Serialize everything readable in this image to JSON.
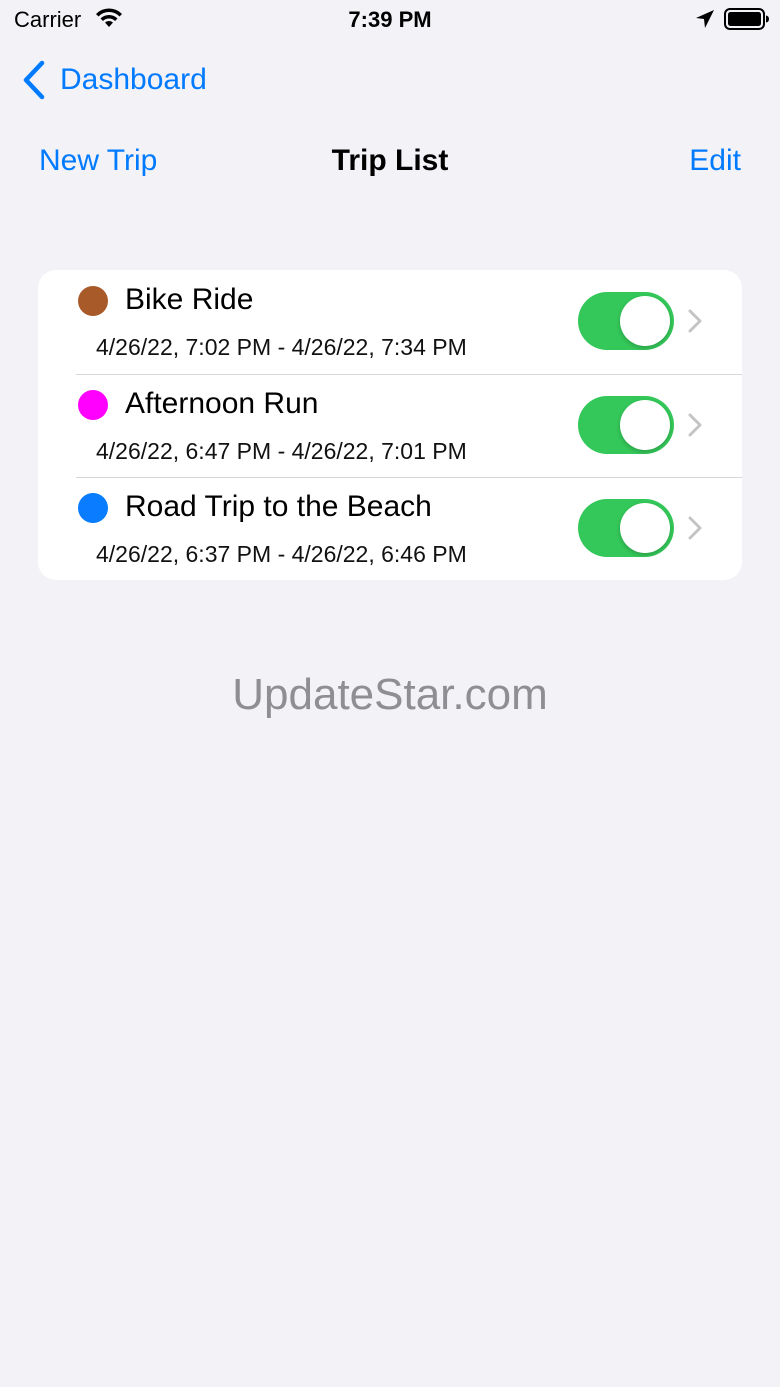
{
  "status_bar": {
    "carrier": "Carrier",
    "time": "7:39 PM",
    "icons": [
      "wifi-icon",
      "location-arrow-icon",
      "battery-icon"
    ]
  },
  "nav": {
    "back_label": "Dashboard",
    "left_action": "New Trip",
    "title": "Trip List",
    "right_action": "Edit"
  },
  "trips": [
    {
      "name": "Bike Ride",
      "dates": "4/26/22, 7:02 PM - 4/26/22, 7:34 PM",
      "color": "#a85a28",
      "enabled": true
    },
    {
      "name": "Afternoon Run",
      "dates": "4/26/22, 6:47 PM - 4/26/22, 7:01 PM",
      "color": "#ff00ff",
      "enabled": true
    },
    {
      "name": "Road Trip to the Beach",
      "dates": "4/26/22, 6:37 PM - 4/26/22, 6:46 PM",
      "color": "#0a7cff",
      "enabled": true
    }
  ],
  "watermark": "UpdateStar.com",
  "colors": {
    "accent": "#007aff",
    "toggle_on": "#34c759",
    "background": "#f2f2f7"
  }
}
